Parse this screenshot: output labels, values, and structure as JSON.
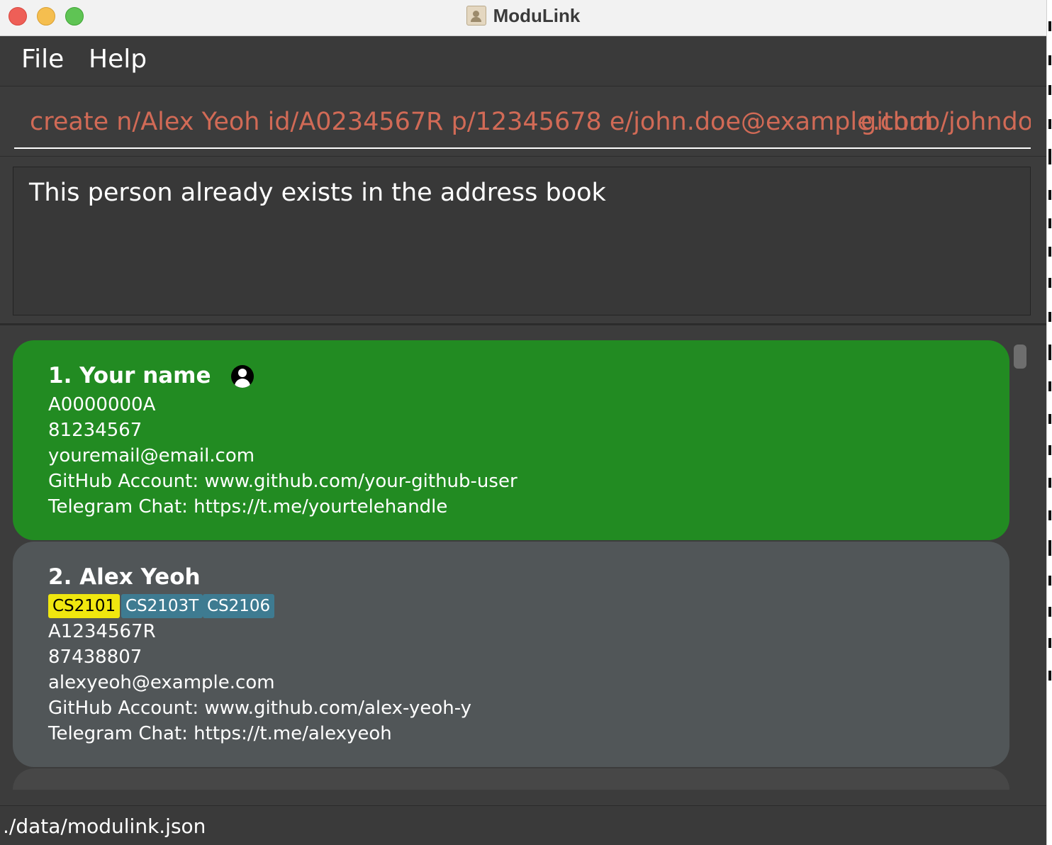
{
  "window": {
    "title": "ModuLink",
    "app_icon": "address-book-icon"
  },
  "menu": {
    "items": [
      "File",
      "Help"
    ]
  },
  "command_box": {
    "value": "create n/Alex Yeoh id/A0234567R p/12345678 e/john.doe@example.com",
    "value_cont": "github/johndo"
  },
  "result_display": {
    "text": "This person already exists in the address book"
  },
  "persons": [
    {
      "index_name": "1. Your name",
      "is_self_icon": "user-icon",
      "id": "A0000000A",
      "phone": "81234567",
      "email": "youremail@email.com",
      "github": "GitHub Account: www.github.com/your-github-user",
      "telegram": "Telegram Chat: https://t.me/yourtelehandle",
      "highlight_color": "#228b22"
    },
    {
      "index_name": "2. Alex Yeoh",
      "tags": [
        "CS2101",
        "CS2103T",
        "CS2106"
      ],
      "id": "A1234567R",
      "phone": "87438807",
      "email": "alexyeoh@example.com",
      "github": "GitHub Account: www.github.com/alex-yeoh-y",
      "telegram": "Telegram Chat: https://t.me/alexyeoh",
      "card_color": "#515658"
    }
  ],
  "colors": {
    "tag_highlight": "#f0e70f",
    "tag_default": "#3e7b91",
    "command_text": "#d16a56",
    "background": "#3c3c3c"
  },
  "status_bar": {
    "path": "./data/modulink.json"
  }
}
